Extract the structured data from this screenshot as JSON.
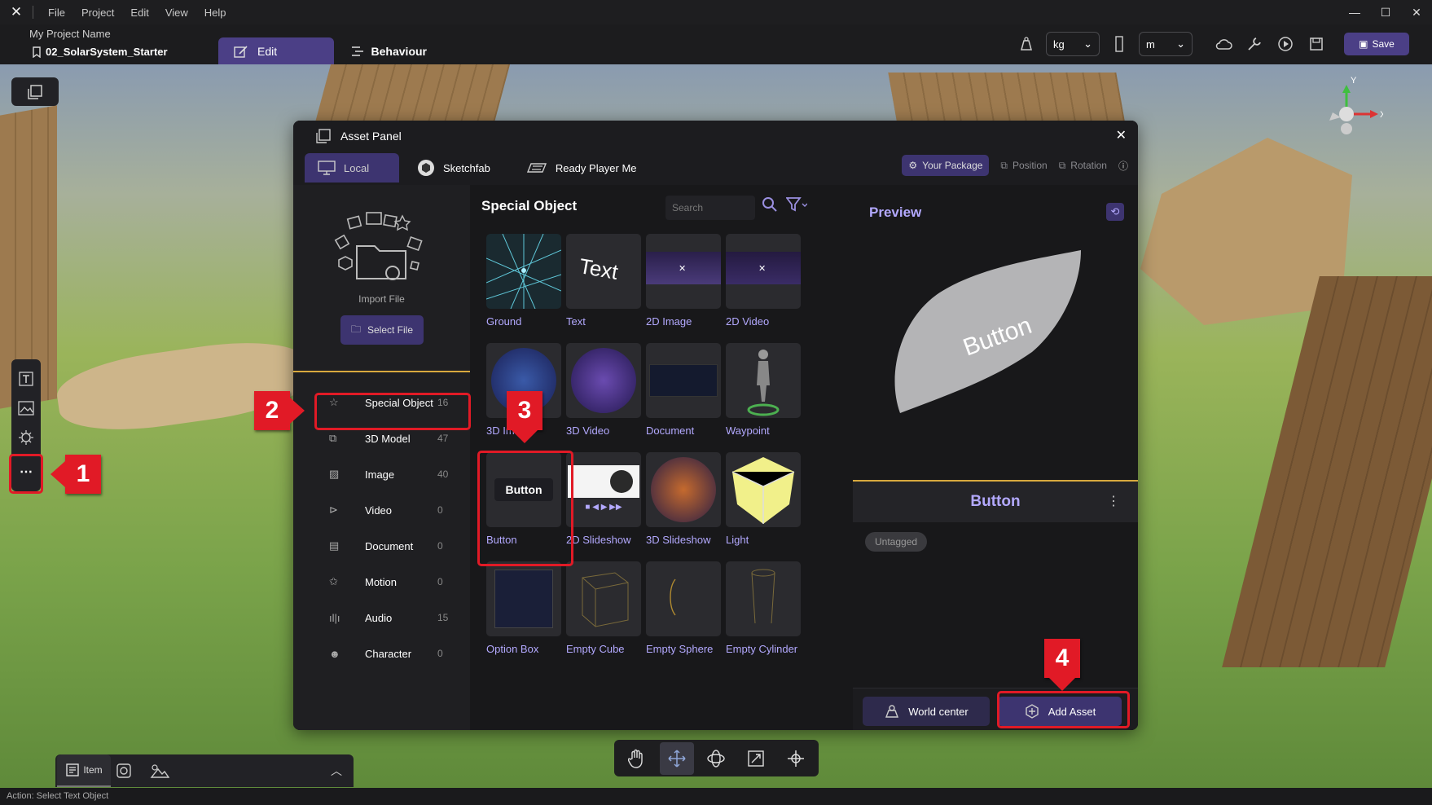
{
  "menubar": {
    "items": [
      "File",
      "Project",
      "Edit",
      "View",
      "Help"
    ]
  },
  "header": {
    "project_name": "My Project Name",
    "scene_name": "02_SolarSystem_Starter",
    "tabs": [
      {
        "label": "Edit"
      },
      {
        "label": "Behaviour"
      }
    ],
    "unit_mass": "kg",
    "unit_length": "m",
    "save_label": "Save"
  },
  "callouts": [
    "1",
    "2",
    "3",
    "4"
  ],
  "asset_panel": {
    "title": "Asset Panel",
    "tabs": [
      {
        "label": "Local"
      },
      {
        "label": "Sketchfab"
      },
      {
        "label": "Ready Player Me"
      }
    ],
    "right_controls": {
      "package": "Your Package",
      "position": "Position",
      "rotation": "Rotation"
    },
    "import": {
      "label": "Import File",
      "button": "Select File"
    },
    "categories": [
      {
        "name": "Special Object",
        "count": "16"
      },
      {
        "name": "3D Model",
        "count": "47"
      },
      {
        "name": "Image",
        "count": "40"
      },
      {
        "name": "Video",
        "count": "0"
      },
      {
        "name": "Document",
        "count": "0"
      },
      {
        "name": "Motion",
        "count": "0"
      },
      {
        "name": "Audio",
        "count": "15"
      },
      {
        "name": "Character",
        "count": "0"
      }
    ],
    "section_title": "Special Object",
    "search_placeholder": "Search",
    "items": [
      {
        "label": "Ground"
      },
      {
        "label": "Text"
      },
      {
        "label": "2D Image"
      },
      {
        "label": "2D Video"
      },
      {
        "label": "3D Image"
      },
      {
        "label": "3D Video"
      },
      {
        "label": "Document"
      },
      {
        "label": "Waypoint"
      },
      {
        "label": "Button"
      },
      {
        "label": "2D Slideshow"
      },
      {
        "label": "3D Slideshow"
      },
      {
        "label": "Light"
      },
      {
        "label": "Option Box"
      },
      {
        "label": "Empty Cube"
      },
      {
        "label": "Empty Sphere"
      },
      {
        "label": "Empty Cylinder"
      }
    ],
    "thumb_text": {
      "text": "Text",
      "button": "Button"
    },
    "preview": {
      "title": "Preview",
      "model_text": "Button",
      "object_name": "Button",
      "tag": "Untagged",
      "world_center": "World center",
      "add_asset": "Add Asset"
    }
  },
  "bottom": {
    "item_tab": "Item"
  },
  "status": "Action: Select Text Object",
  "gizmo": {
    "y": "Y",
    "x": "X"
  },
  "colors": {
    "accent": "#3d3470",
    "highlight": "#e11a26",
    "label": "#b3a9ff",
    "divider": "#d8a93e"
  }
}
